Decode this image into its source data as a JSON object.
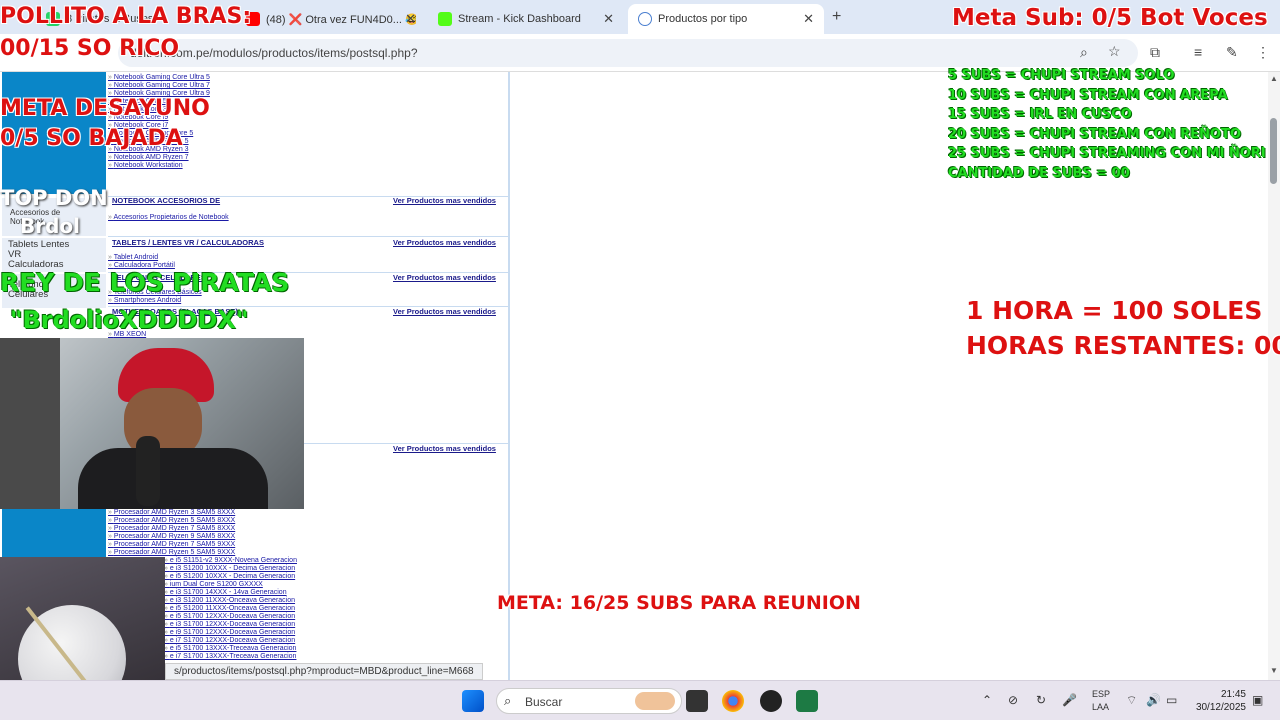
{
  "browser": {
    "tabs": [
      {
        "title": "3 Pirates & Buses",
        "color": "#25d366"
      },
      {
        "title": "(48) ❌ Otra vez FUN4D0... 😂",
        "color": "#ff0000"
      },
      {
        "title": "Stream - Kick Dashboard",
        "color": "#53fc18"
      },
      {
        "title": "Productos por tipo",
        "color": "#ffffff"
      }
    ],
    "url": "deltron.com.pe/modulos/productos/items/postsql.php?",
    "status_url": "s/productos/items/postsql.php?mproduct=MBD&product_line=M668"
  },
  "page": {
    "notebook_links": [
      "Notebook Gaming Core Ultra 5",
      "Notebook Gaming Core Ultra 7",
      "Notebook Gaming Core Ultra 9",
      "Notebook Core 5",
      "Notebook Core 3",
      "Notebook Core i9",
      "Notebook Core i7",
      "Notebook Gaming Core 5",
      "Notebook AMD Ryzen 5",
      "Notebook AMD Ryzen 3",
      "Notebook AMD Ryzen 7",
      "Notebook Workstation"
    ],
    "accessories": {
      "title": "NOTEBOOK ACCESORIOS DE",
      "links": [
        "Accesorios Propietarios de Notebook"
      ],
      "thumb_label": "Accesorios de Notebook"
    },
    "tablets": {
      "title": "TABLETS / LENTES VR / CALCULADORAS",
      "links": [
        "Tablet Android",
        "Calculadora Portátil"
      ],
      "thumb_label": "Tablets Lentes VR Calculadoras"
    },
    "phones": {
      "title": "TELEFONOS CELULARES",
      "links": [
        "Teléfonos Celulares Básicos",
        "Smartphones Android"
      ],
      "thumb_label": "Telefonos Celulares"
    },
    "motherboards": {
      "title": "MOTHERBOARDS (PLACAS BASE)",
      "links": [
        "MB XEON"
      ]
    },
    "see_more": "Ver Productos mas vendidos",
    "processors": [
      "Procesador AMD Ryzen 3 SAM5 8XXX",
      "Procesador AMD Ryzen 5 SAM5 8XXX",
      "Procesador AMD Ryzen 7 SAM5 8XXX",
      "Procesador AMD Ryzen 9 SAM5 8XXX",
      "Procesador AMD Ryzen 7 SAM5 9XXX",
      "Procesador AMD Ryzen 5 SAM5 9XXX",
      "e i5 S1151-v2 9XXX-Novena Generacion",
      "e i3 S1200 10XXX - Decima Generacion",
      "e i5 S1200 10XXX - Decima Generacion",
      "ium Dual Core S1200 GXXXX",
      "e i3 S1700 14XXX - 14va Generacion",
      "e i3 S1200 11XXX-Onceava Generacion",
      "e i5 S1200 11XXX-Onceava Generacion",
      "e i5 S1700 12XXX-Doceava Generacion",
      "e i3 S1700 12XXX-Doceava Generacion",
      "e i9 S1700 12XXX-Doceava Generacion",
      "e i7 S1700 12XXX-Doceava Generacion",
      "e i5 S1700 13XXX-Treceava Generacion",
      "e i7 S1700 13XXX-Treceava Generacion"
    ]
  },
  "overlays": {
    "top_left_1": "POLLITO A LA BRAS:",
    "top_left_2": "00/15 SO RICO",
    "meta_desayuno_1": "META DESAYUNO",
    "meta_desayuno_2": "0/5 SO BAJADA",
    "top_don": "TOP DON",
    "brdol": "Brdol",
    "rey": "REY DE LOS PIRATAS",
    "brdolio": "\"BrdolioXDDDDX\"",
    "meta_sub": "Meta Sub: 0/5 Bot Voces",
    "subs_list": [
      "5 SUBS = CHUPI STREAM SOLO",
      "10 SUBS = CHUPI STREAM CON AREPA",
      "15 SUBS = IRL EN CUSCO",
      "20 SUBS = CHUPI STREAM CON REÑOTO",
      "25 SUBS = CHUPI STREAMING CON MI ÑORI",
      "CANTIDAD DE SUBS = 00"
    ],
    "hora_1": "1 HORA = 100 SOLES",
    "hora_2": "HORAS RESTANTES: 00",
    "meta_reunion": "META: 16/25 SUBS PARA REUNION"
  },
  "taskbar": {
    "search_placeholder": "Buscar",
    "lang_1": "ESP",
    "lang_2": "LAA",
    "time": "21:45",
    "date": "30/12/2025"
  }
}
